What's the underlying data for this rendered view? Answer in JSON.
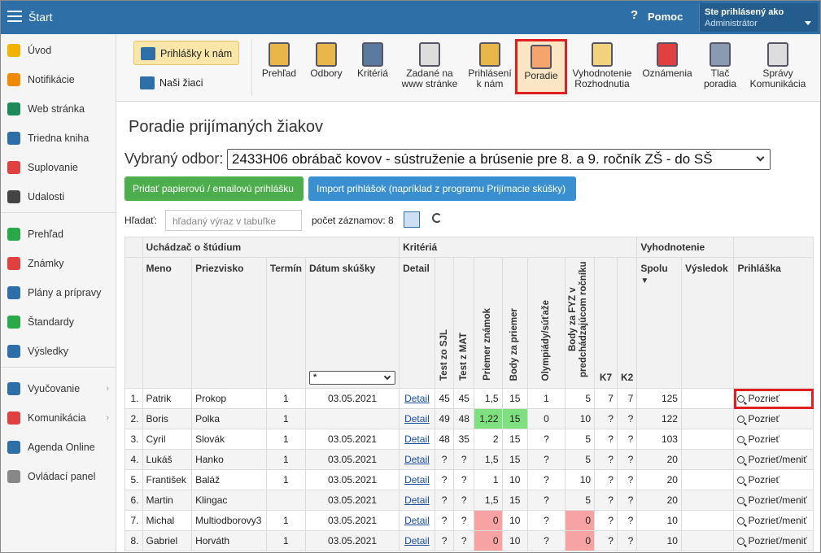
{
  "topbar": {
    "title": "Štart",
    "help": "Pomoc",
    "user_line1": "Ste prihlásený ako",
    "user_line2": "Administrátor"
  },
  "sidebar": {
    "items": [
      {
        "label": "Úvod",
        "icon": "star-icon",
        "color": "#f0b400"
      },
      {
        "label": "Notifikácie",
        "icon": "envelope-icon",
        "color": "#f08a00"
      },
      {
        "label": "Web stránka",
        "icon": "home-icon",
        "color": "#1e8a5a"
      },
      {
        "label": "Triedna kniha",
        "icon": "book-icon",
        "color": "#2f6fa8"
      },
      {
        "label": "Suplovanie",
        "icon": "person-icon",
        "color": "#e04040"
      },
      {
        "label": "Udalosti",
        "icon": "calendar-icon",
        "color": "#444444"
      },
      {
        "label": "Prehľad",
        "icon": "check-circle-icon",
        "color": "#2aa84a"
      },
      {
        "label": "Známky",
        "icon": "chart-circle-icon",
        "color": "#e04040"
      },
      {
        "label": "Plány a prípravy",
        "icon": "briefcase-icon",
        "color": "#2f6fa8"
      },
      {
        "label": "Štandardy",
        "icon": "shield-icon",
        "color": "#2aa84a"
      },
      {
        "label": "Výsledky",
        "icon": "bar-chart-icon",
        "color": "#2f6fa8"
      },
      {
        "label": "Vyučovanie",
        "icon": "open-book-icon",
        "color": "#2f6fa8",
        "arrow": "›"
      },
      {
        "label": "Komunikácia",
        "icon": "chat-icon",
        "color": "#e04040",
        "arrow": "›"
      },
      {
        "label": "Agenda Online",
        "icon": "pen-icon",
        "color": "#2f6fa8"
      },
      {
        "label": "Ovládací panel",
        "icon": "gear-icon",
        "color": "#888888"
      }
    ]
  },
  "toolbar": {
    "left_buttons": [
      "Prihlášky k nám",
      "Naši žiaci"
    ],
    "buttons": [
      {
        "label": "Prehľad",
        "icon": "clipboard-eye-icon"
      },
      {
        "label": "Odbory",
        "icon": "clipboard-search-icon"
      },
      {
        "label": "Kritériá",
        "icon": "table-import-icon"
      },
      {
        "label": "Zadané na www stránke",
        "icon": "document-icon"
      },
      {
        "label": "Prihlásení k nám",
        "icon": "clipboard-check-icon"
      },
      {
        "label": "Poradie",
        "icon": "warning-document-icon"
      },
      {
        "label": "Vyhodnotenie Rozhodnutia",
        "icon": "certificate-icon"
      },
      {
        "label": "Oznámenia",
        "icon": "clock-icon"
      },
      {
        "label": "Tlač poradia",
        "icon": "printer-icon"
      },
      {
        "label": "Správy Komunikácia",
        "icon": "documents-icon"
      }
    ]
  },
  "page": {
    "title": "Poradie prijímaných žiakov",
    "odbor_label": "Vybraný odbor:",
    "odbor_value": "2433H06 obrábač kovov - sústruženie a brúsenie pre 8. a 9. ročník ZŠ - do SŠ",
    "btn_add": "Pridať papierovú / emailovú prihlášku",
    "btn_import": "Import prihlášok (napríklad z programu Prijímacie skúšky)",
    "search_label": "Hľadať:",
    "search_placeholder": "hľadaný výraz v tabuľke",
    "count_text": "počet záznamov: 8",
    "date_filter": "*"
  },
  "table": {
    "groups": [
      "Uchádzač o štúdium",
      "Kritériá",
      "Vyhodnotenie"
    ],
    "headers": [
      "Meno",
      "Priezvisko",
      "Termín",
      "Dátum skúšky",
      "Detail",
      "Test zo SJL",
      "Test z MAT",
      "Priemer známok",
      "Body za priemer",
      "Olympiády/súťaže",
      "Body za FYZ v predchádzajúcom ročníku",
      "K7",
      "K2",
      "Spolu",
      "Výsledok",
      "Prihláška"
    ],
    "sort_indicator": "▼",
    "rows": [
      [
        "1.",
        "Patrik",
        "Prokop",
        "1",
        "03.05.2021",
        "Detail",
        "45",
        "45",
        "1,5",
        "15",
        "1",
        "5",
        "7",
        "7",
        "125",
        "",
        "Pozrieť"
      ],
      [
        "2.",
        "Boris",
        "Polka",
        "1",
        "",
        "Detail",
        "49",
        "48",
        "1,22",
        "15",
        "0",
        "10",
        "?",
        "?",
        "122",
        "",
        "Pozrieť"
      ],
      [
        "3.",
        "Cyril",
        "Slovák",
        "1",
        "03.05.2021",
        "Detail",
        "48",
        "35",
        "2",
        "15",
        "?",
        "5",
        "?",
        "?",
        "103",
        "",
        "Pozrieť"
      ],
      [
        "4.",
        "Lukáš",
        "Hanko",
        "1",
        "03.05.2021",
        "Detail",
        "?",
        "?",
        "1,5",
        "15",
        "?",
        "5",
        "?",
        "?",
        "20",
        "",
        "Pozrieť/meniť"
      ],
      [
        "5.",
        "František",
        "Baláž",
        "1",
        "03.05.2021",
        "Detail",
        "?",
        "?",
        "1",
        "10",
        "?",
        "10",
        "?",
        "?",
        "20",
        "",
        "Pozrieť"
      ],
      [
        "6.",
        "Martin",
        "Klingac",
        "",
        "03.05.2021",
        "Detail",
        "?",
        "?",
        "1,5",
        "15",
        "?",
        "5",
        "?",
        "?",
        "20",
        "",
        "Pozrieť/meniť"
      ],
      [
        "7.",
        "Michal",
        "Multiodborovy3",
        "1",
        "03.05.2021",
        "Detail",
        "?",
        "?",
        "0",
        "10",
        "?",
        "0",
        "?",
        "?",
        "10",
        "",
        "Pozrieť/meniť"
      ],
      [
        "8.",
        "Gabriel",
        "Horváth",
        "1",
        "03.05.2021",
        "Detail",
        "?",
        "?",
        "0",
        "10",
        "?",
        "0",
        "?",
        "?",
        "10",
        "",
        "Pozrieť/meniť"
      ]
    ]
  }
}
